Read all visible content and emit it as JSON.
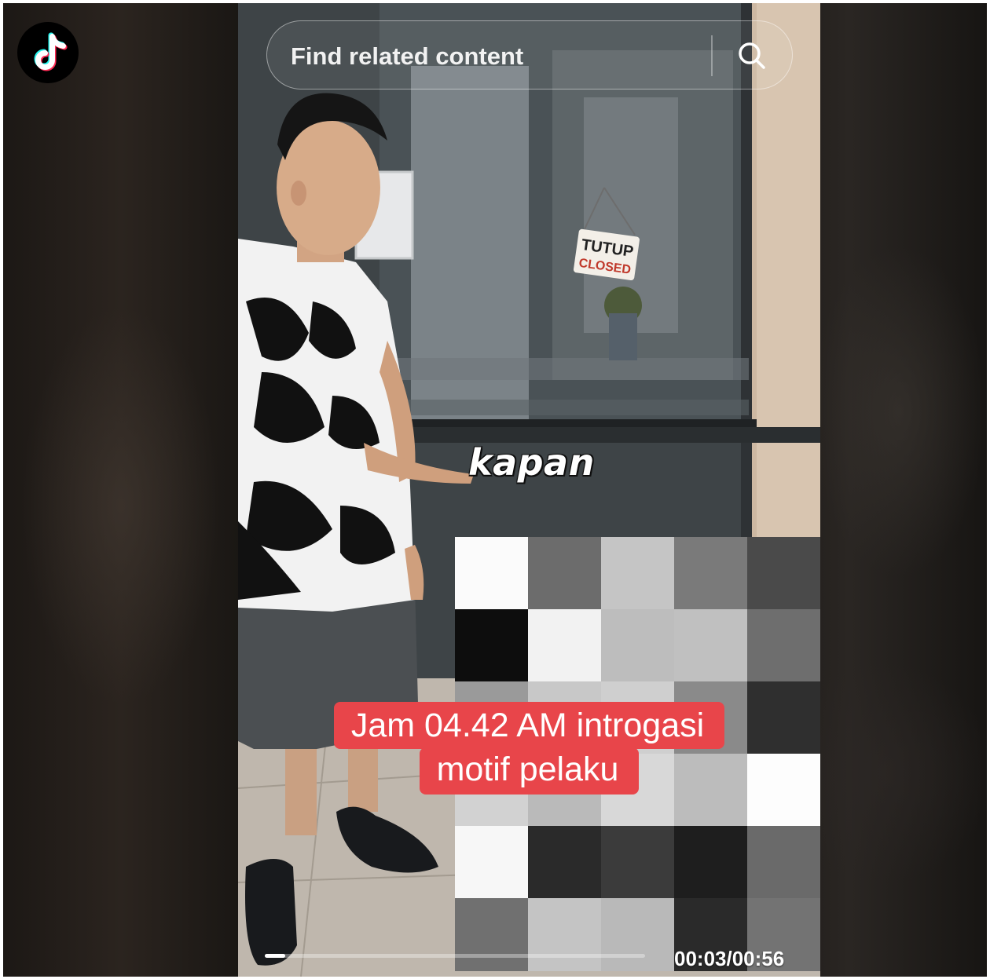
{
  "app": {
    "logo_icon": "tiktok-logo"
  },
  "search": {
    "placeholder": "Find related content",
    "value": "",
    "icon": "search-icon"
  },
  "video": {
    "sticker_text": "kapan",
    "sign_line1": "TUTUP",
    "sign_line2": "CLOSED",
    "caption_line1": "Jam 04.42 AM introgasi",
    "caption_line2": "motif pelaku",
    "caption_color": "#e8454a",
    "time_display": "00:03/00:56",
    "progress_fraction": 0.0536
  },
  "mosaic": {
    "shades": [
      "#fbfbfb",
      "#6c6c6c",
      "#c5c5c5",
      "#7a7a7a",
      "#4a4a4a",
      "#0d0d0d",
      "#f2f2f2",
      "#bdbdbd",
      "#c0c0c0",
      "#6e6e6e",
      "#9a9a9a",
      "#c8c8c8",
      "#cfcfcf",
      "#8a8a8a",
      "#2f2f2f",
      "#d2d2d2",
      "#bababa",
      "#d8d8d8",
      "#bcbcbc",
      "#fdfdfd",
      "#f7f7f7",
      "#2a2a2a",
      "#3b3b3b",
      "#1e1e1e",
      "#6a6a6a",
      "#707070",
      "#c4c4c4",
      "#b9b9b9",
      "#2a2a2a",
      "#737373"
    ]
  }
}
